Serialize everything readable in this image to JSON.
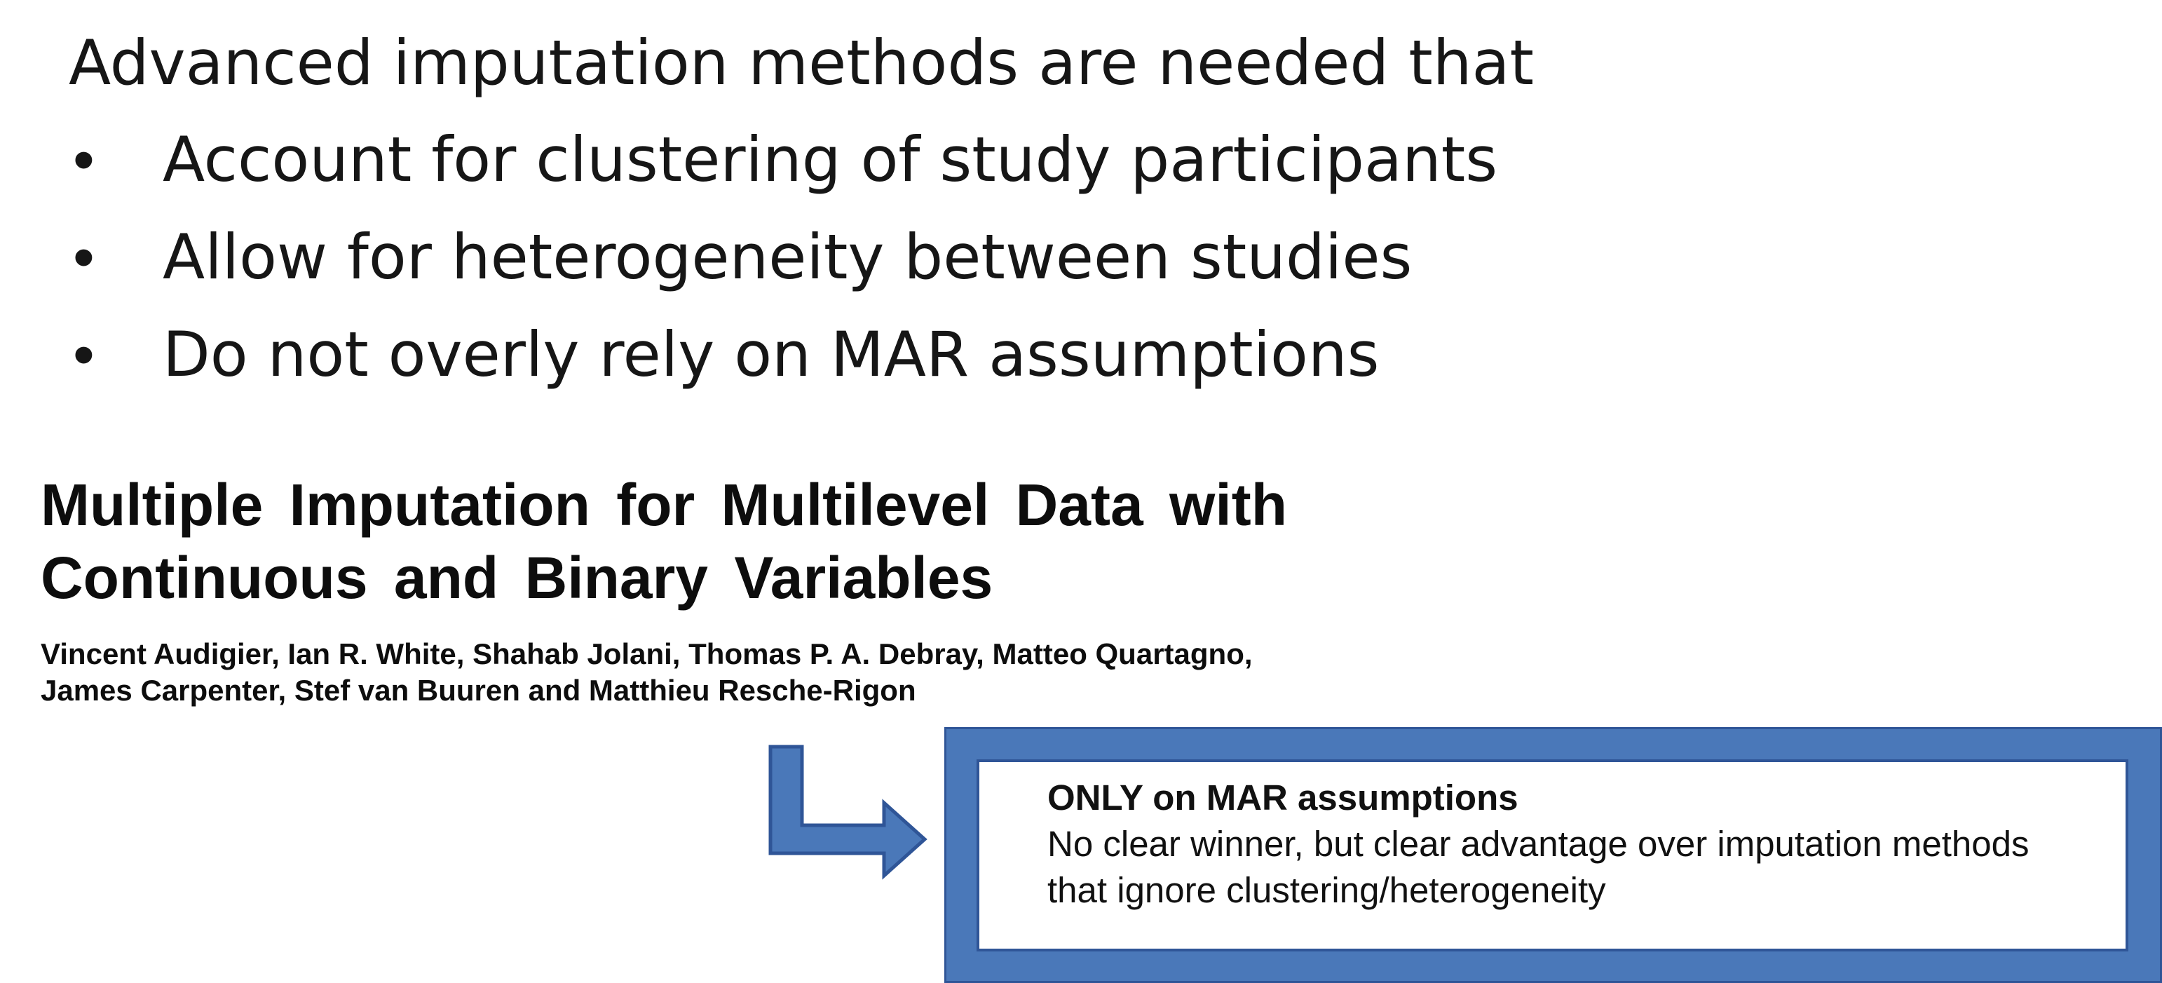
{
  "intro": "Advanced imputation methods are needed that",
  "bullets": [
    "Account for clustering of study participants",
    "Allow for heterogeneity between studies",
    "Do not overly rely on MAR assumptions"
  ],
  "bullet_marker": "•",
  "paper": {
    "title_line1": "Multiple Imputation for Multilevel Data with",
    "title_line2": "Continuous and Binary Variables",
    "authors_line1": "Vincent Audigier, Ian R. White, Shahab Jolani, Thomas P. A. Debray, Matteo Quartagno,",
    "authors_line2": "James Carpenter, Stef van Buuren and Matthieu Resche-Rigon"
  },
  "callout": {
    "heading": "ONLY on MAR assumptions",
    "line1": "No clear winner, but clear advantage over imputation methods",
    "line2": "that ignore clustering/heterogeneity"
  },
  "colors": {
    "callout_fill": "#4a78b9",
    "callout_border": "#2f5597",
    "arrow_fill": "#4a78b9"
  },
  "icons": {
    "arrow": "bent-arrow-right-icon"
  }
}
